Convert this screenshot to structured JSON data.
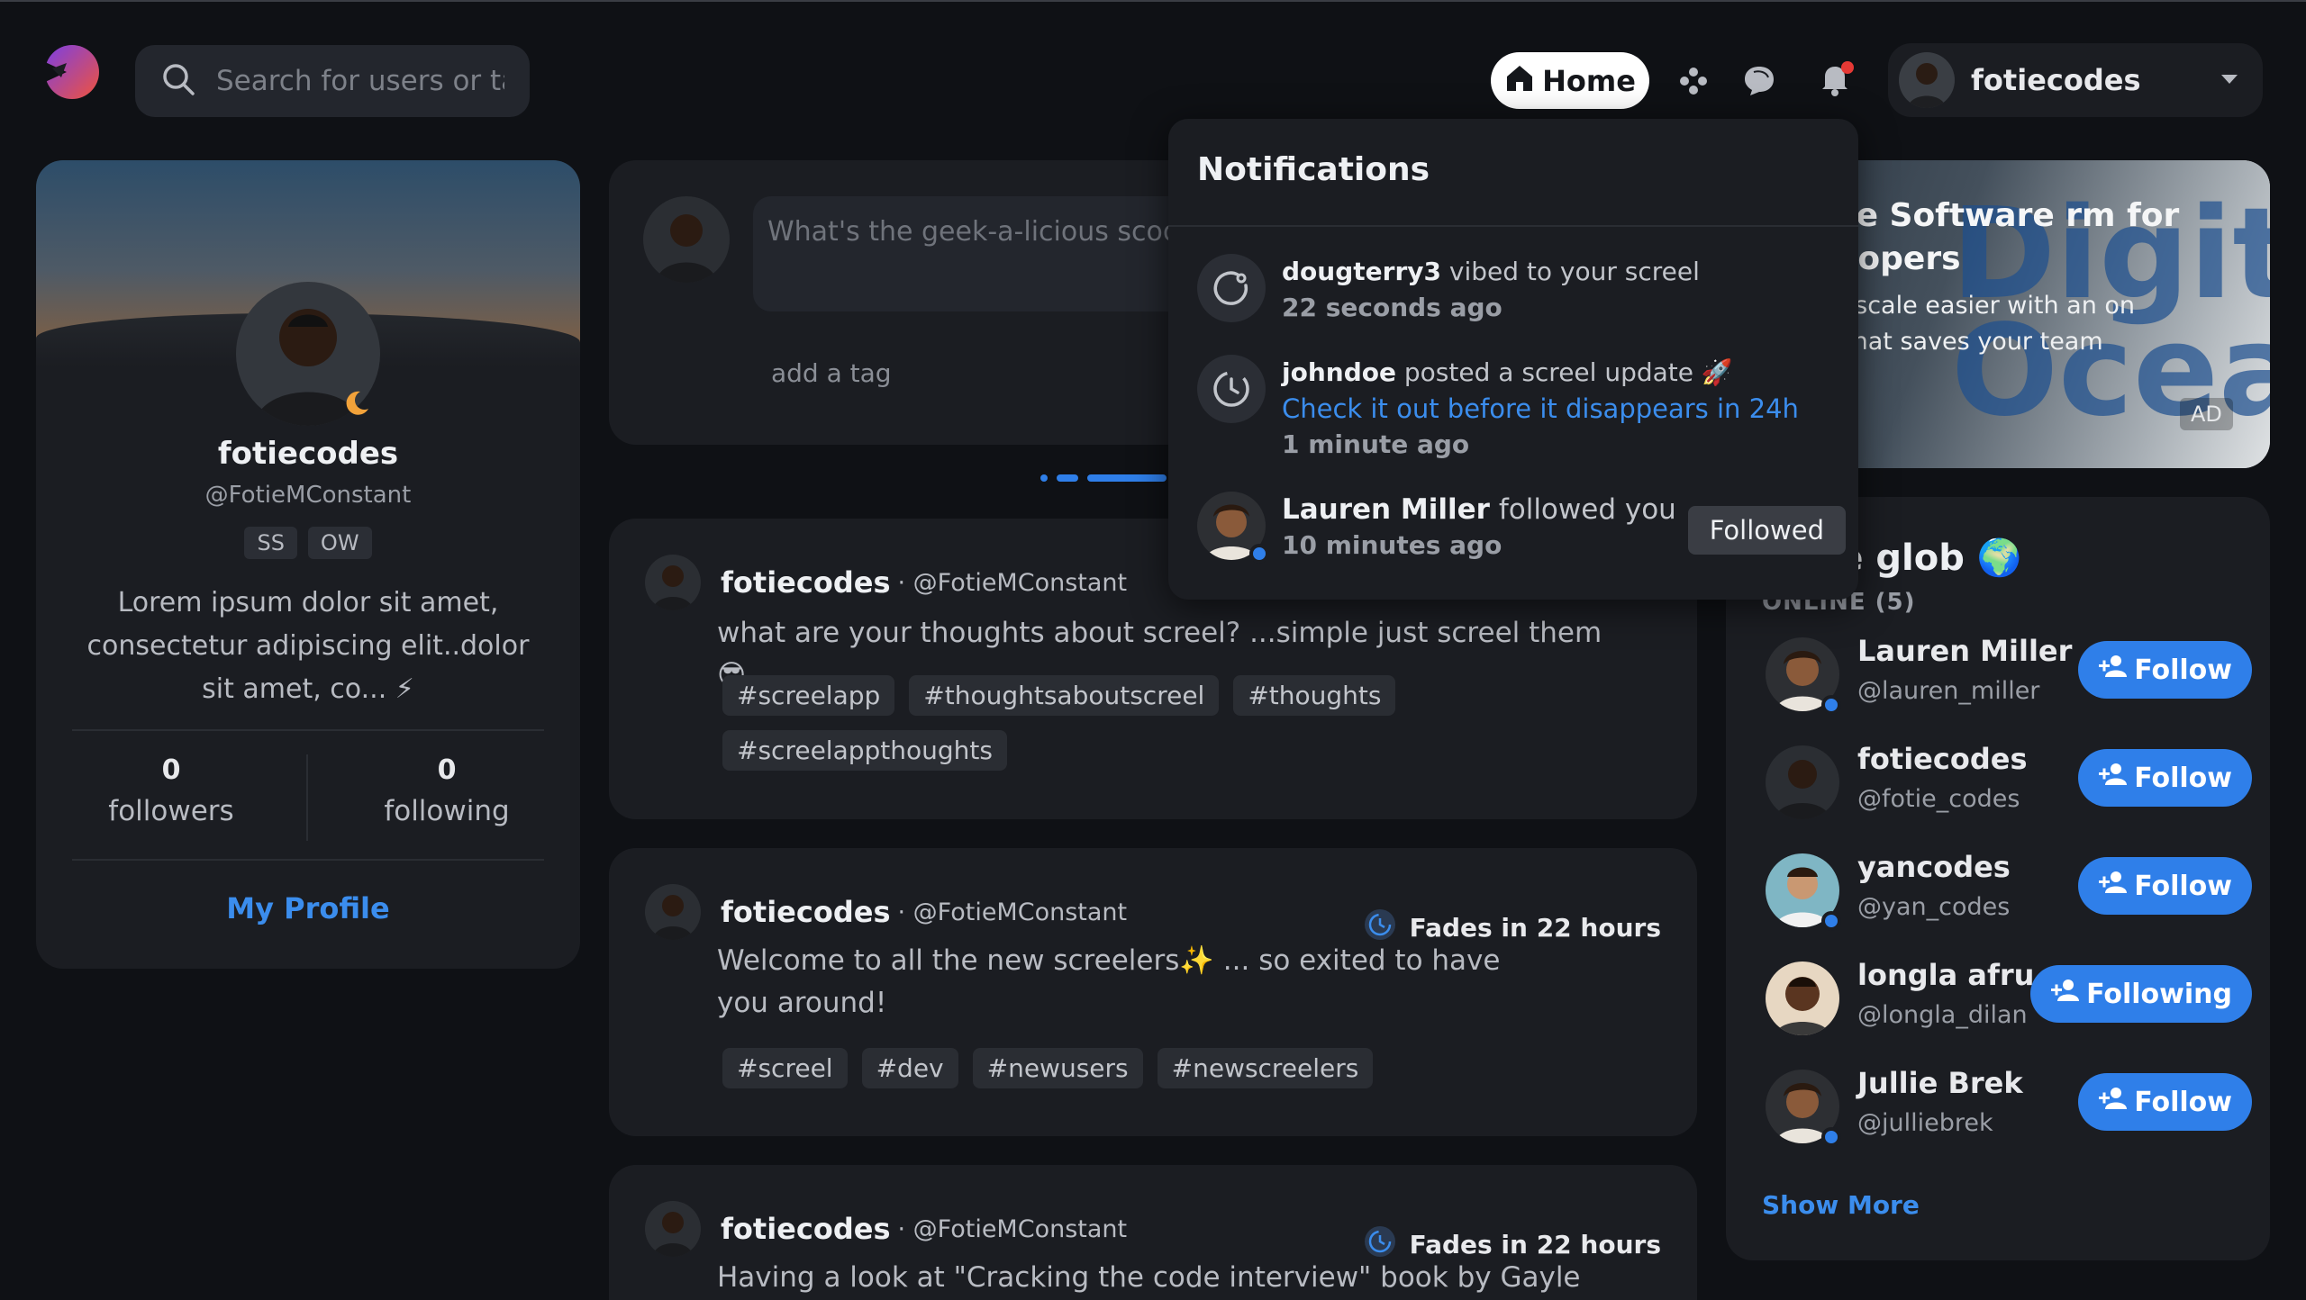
{
  "header": {
    "search_placeholder": "Search for users or ta",
    "home_label": "Home",
    "username": "fotiecodes"
  },
  "profile": {
    "name": "fotiecodes",
    "handle": "@FotieMConstant",
    "badges": [
      "SS",
      "OW"
    ],
    "bio": "Lorem ipsum dolor sit amet, consectetur adipiscing elit..dolor sit amet, co... ⚡",
    "followers_count": "0",
    "followers_label": "followers",
    "following_count": "0",
    "following_label": "following",
    "my_profile_label": "My Profile"
  },
  "composer": {
    "placeholder": "What's the geek-a-licious scoop",
    "add_tag": "add a tag"
  },
  "posts": [
    {
      "user": "fotiecodes",
      "handle": "· @FotieMConstant",
      "fade": "",
      "text": "what are your thoughts about screel? ...simple just screel them😎",
      "tags": [
        "#screelapp",
        "#thoughtsaboutscreel",
        "#thoughts",
        "#screelappthoughts"
      ]
    },
    {
      "user": "fotiecodes",
      "handle": "· @FotieMConstant",
      "fade": "Fades in 22 hours",
      "text": "Welcome to all the new screelers✨ ... so exited to have you around!",
      "tags": [
        "#screel",
        "#dev",
        "#newusers",
        "#newscreelers"
      ]
    },
    {
      "user": "fotiecodes",
      "handle": "· @FotieMConstant",
      "fade": "Fades in 22 hours",
      "text": "Having a look at \"Cracking the code interview\" book by Gayle",
      "tags": []
    }
  ],
  "ad": {
    "title": "timate Software rm for developers",
    "description": "aster & scale easier with an on server that saves your team noney.",
    "watermark": "Digita Ocea",
    "label": "AD"
  },
  "people": {
    "title": "s the glob 🌍",
    "online_label": "ONLINE (5)",
    "items": [
      {
        "name": "Lauren Miller",
        "handle": "@lauren_miller",
        "button": "Follow"
      },
      {
        "name": "fotiecodes",
        "handle": "@fotie_codes",
        "button": "Follow"
      },
      {
        "name": "yancodes",
        "handle": "@yan_codes",
        "button": "Follow"
      },
      {
        "name": "longla afru",
        "handle": "@longla_dilan",
        "button": "Following"
      },
      {
        "name": "Jullie Brek",
        "handle": "@julliebrek",
        "button": "Follow"
      }
    ],
    "show_more": "Show More"
  },
  "notifications": {
    "title": "Notifications",
    "items": [
      {
        "user": "dougterry3",
        "action": " vibed to your screel",
        "link": "",
        "time": "22 seconds ago",
        "button": ""
      },
      {
        "user": "johndoe",
        "action": " posted a screel update 🚀",
        "link": "Check it out before it disappears in 24h",
        "time": "1 minute ago",
        "button": ""
      },
      {
        "user": "Lauren Miller",
        "action": " followed you",
        "link": "",
        "time": "10 minutes ago",
        "button": "Followed"
      }
    ]
  },
  "colors": {
    "background": "#0f1115",
    "card": "#1b1d22",
    "accent": "#2f7fe9",
    "link": "#3b8ded",
    "notification_dot": "#e53935"
  }
}
